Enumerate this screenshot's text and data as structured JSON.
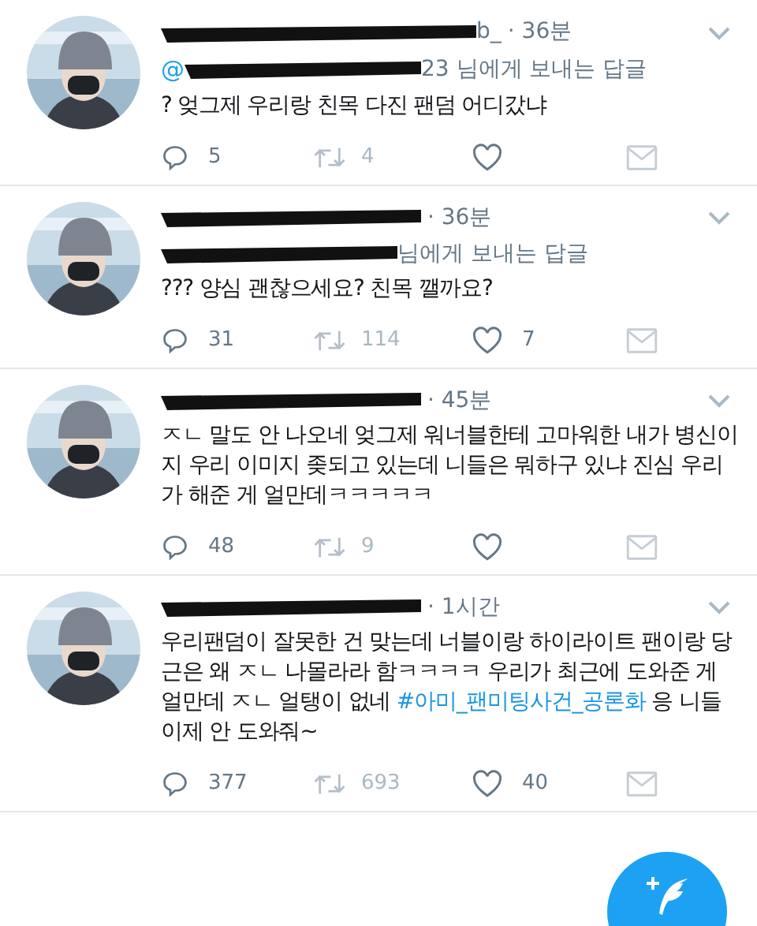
{
  "tweets": [
    {
      "handle_tail": "b_",
      "time": "· 36분",
      "reply_to": {
        "prefix": "@",
        "suffix": "23 님에게 보내는 답글"
      },
      "text": [
        {
          "kind": "plain",
          "text": "? 엊그제 우리랑 친목 다진 팬덤 어디갔냐"
        }
      ],
      "replies": "5",
      "retweets": "4"
    },
    {
      "time": "· 36분",
      "reply_to": {
        "suffix": "님에게 보내는 답글"
      },
      "text": [
        {
          "kind": "plain",
          "text": "??? 양심 괜찮으세요? 친목 깰까요?"
        }
      ],
      "replies": "31",
      "retweets": "114",
      "likes": "7"
    },
    {
      "time": "· 45분",
      "text": [
        {
          "kind": "plain",
          "text": "ㅈㄴ 말도 안 나오네 엊그제 워너블한테 고마워한 내가 병신이지 우리 이미지 좆되고 있는데 니들은 뭐하구 있냐 진심 우리가 해준 게 얼만데ㅋㅋㅋㅋㅋ"
        }
      ],
      "replies": "48",
      "retweets": "9"
    },
    {
      "time": "· 1시간",
      "text": [
        {
          "kind": "plain",
          "text": "우리팬덤이 잘못한 건 맞는데 너블이랑 하이라이트 팬이랑 당근은 왜 ㅈㄴ 나몰라라 함ㅋㅋㅋㅋ 우리가 최근에 도와준 게 얼만데 ㅈㄴ 얼탱이 없네 "
        },
        {
          "kind": "hashtag",
          "text": "#아미_팬미팅사건_공론화"
        },
        {
          "kind": "plain",
          "text": " 응 니들 이제 안 도와줘~"
        }
      ],
      "replies": "377",
      "retweets": "693",
      "likes": "40"
    }
  ]
}
